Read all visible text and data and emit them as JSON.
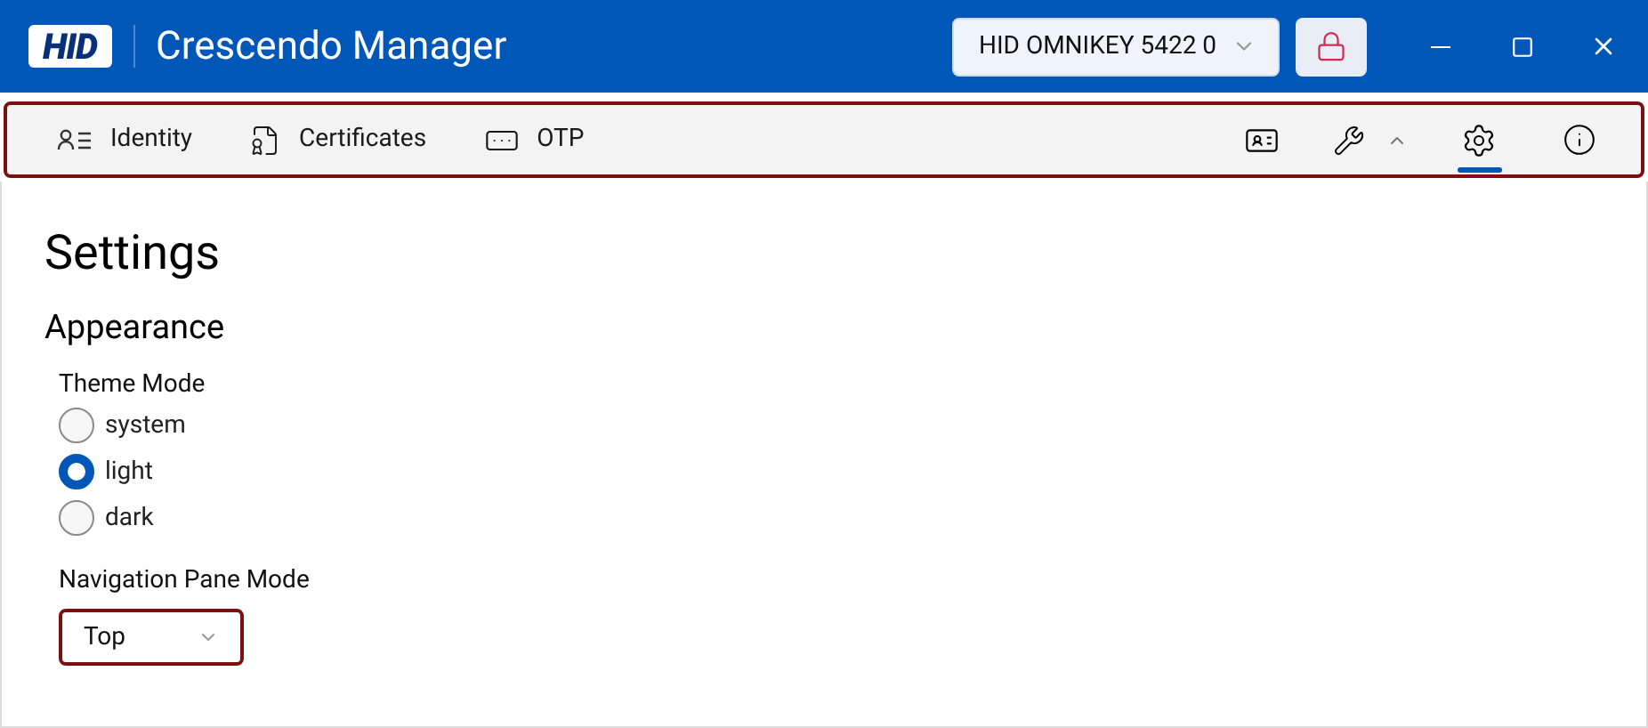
{
  "window": {
    "logo": "HID",
    "title": "Crescendo Manager",
    "device_select": "HID OMNIKEY 5422 0",
    "locked": true
  },
  "nav": {
    "items": [
      {
        "kind": "identity",
        "label": "Identity",
        "selected": false
      },
      {
        "kind": "certificates",
        "label": "Certificates",
        "selected": false
      },
      {
        "kind": "otp",
        "label": "OTP",
        "selected": false
      }
    ],
    "tools": [
      {
        "kind": "card",
        "selected": false
      },
      {
        "kind": "tools",
        "selected": false
      },
      {
        "kind": "settings",
        "selected": true
      },
      {
        "kind": "info",
        "selected": false
      }
    ]
  },
  "page": {
    "title": "Settings",
    "section": "Appearance",
    "theme": {
      "label": "Theme Mode",
      "options": [
        {
          "label": "system",
          "selected": false
        },
        {
          "label": "light",
          "selected": true
        },
        {
          "label": "dark",
          "selected": false
        }
      ]
    },
    "navigation": {
      "label": "Navigation Pane Mode",
      "value": "Top"
    }
  }
}
